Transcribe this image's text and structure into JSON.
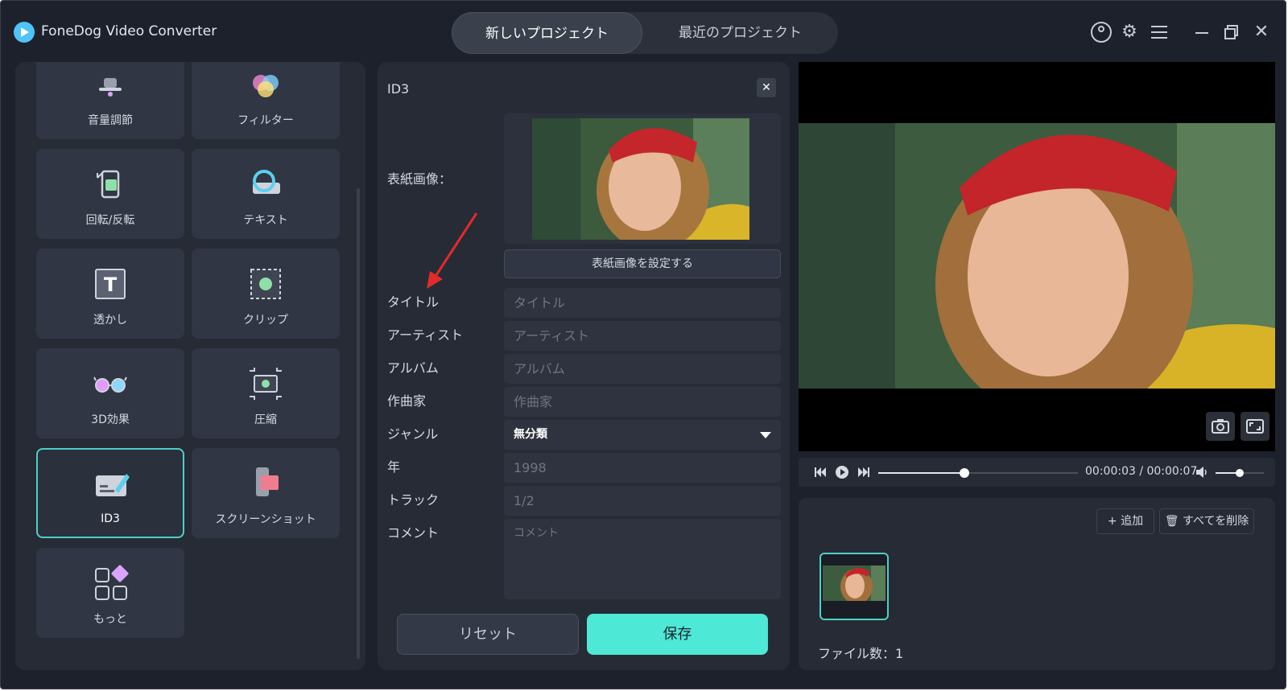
{
  "app": {
    "title": "FoneDog Video Converter"
  },
  "tabs": [
    {
      "label": "新しいプロジェクト",
      "active": true
    },
    {
      "label": "最近のプロジェクト",
      "active": false
    }
  ],
  "window_icons": [
    "user-icon",
    "gear-icon",
    "menu-icon",
    "minimize-icon",
    "maximize-icon",
    "close-icon"
  ],
  "tools": [
    {
      "label": "音量調節",
      "icon": "volume-adjust-icon"
    },
    {
      "label": "フィルター",
      "icon": "filter-icon"
    },
    {
      "label": "回転/反転",
      "icon": "rotate-icon"
    },
    {
      "label": "テキスト",
      "icon": "text-icon"
    },
    {
      "label": "透かし",
      "icon": "watermark-icon"
    },
    {
      "label": "クリップ",
      "icon": "clip-icon"
    },
    {
      "label": "3D効果",
      "icon": "3d-glasses-icon"
    },
    {
      "label": "圧縮",
      "icon": "compress-icon"
    },
    {
      "label": "ID3",
      "icon": "id3-icon",
      "active": true
    },
    {
      "label": "スクリーンショット",
      "icon": "screenshot-icon"
    },
    {
      "label": "もっと",
      "icon": "more-icon"
    }
  ],
  "id3": {
    "title": "ID3",
    "cover_label": "表紙画像：",
    "cover_button": "表紙画像を設定する",
    "fields": {
      "title": {
        "label": "タイトル",
        "placeholder": "タイトル"
      },
      "artist": {
        "label": "アーティスト",
        "placeholder": "アーティスト"
      },
      "album": {
        "label": "アルバム",
        "placeholder": "アルバム"
      },
      "composer": {
        "label": "作曲家",
        "placeholder": "作曲家"
      },
      "genre": {
        "label": "ジャンル",
        "value": "無分類"
      },
      "year": {
        "label": "年",
        "value": "1998"
      },
      "track": {
        "label": "トラック",
        "value": "1/2"
      },
      "comment": {
        "label": "コメント",
        "placeholder": "コメント"
      }
    },
    "reset_button": "リセット",
    "save_button": "保存"
  },
  "player": {
    "time": "00:00:03 / 00:00:07",
    "progress": 0.43,
    "volume": 0.5
  },
  "files": {
    "add_button": "+ 追加",
    "delete_all_button": "🗑 すべてを削除",
    "count_text": "ファイル数：1"
  },
  "colors": {
    "accent": "#4ee8d6",
    "background": "#1d212b",
    "panel": "#262b36",
    "arrow": "#e02b2b"
  }
}
